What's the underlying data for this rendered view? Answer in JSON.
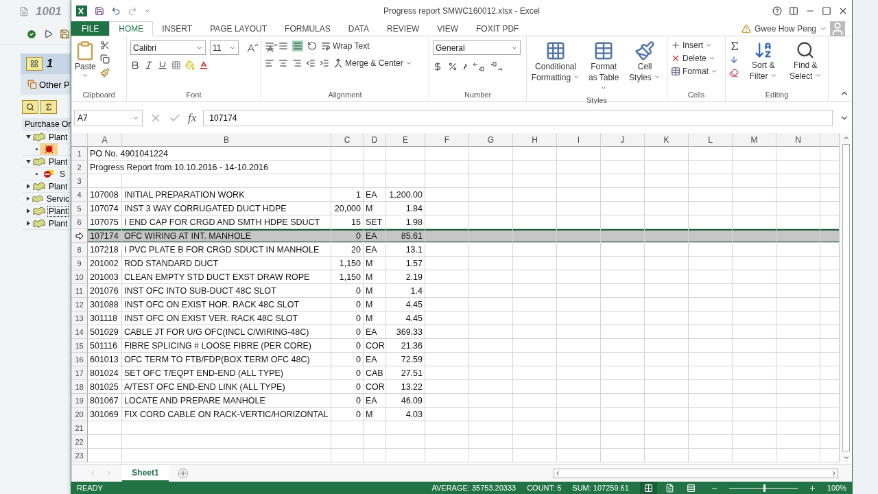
{
  "sap": {
    "title": "1001",
    "app_button": "1",
    "other_button": "Other P",
    "tree_header": "Purchase Or",
    "tree": [
      {
        "label": "Plant",
        "expanded": true,
        "selected": false,
        "children": [
          {
            "kind": "error",
            "selected": true
          }
        ]
      },
      {
        "label": "Plant",
        "expanded": true,
        "selected": false,
        "children": [
          {
            "kind": "stop",
            "label": "S",
            "selected": false
          }
        ]
      },
      {
        "label": "Plant",
        "expanded": false,
        "selected": false
      },
      {
        "label": "Servic",
        "expanded": false,
        "selected": false
      },
      {
        "label": "Plant",
        "expanded": false,
        "selected": true
      },
      {
        "label": "Plant",
        "expanded": false,
        "selected": false
      }
    ]
  },
  "excel": {
    "title": "Progress report SMWC160012.xlsx - Excel",
    "account": "Gwee How Peng",
    "tabs": [
      {
        "label": "FILE",
        "kind": "file",
        "selected": false
      },
      {
        "label": "HOME",
        "kind": "tab",
        "selected": true
      },
      {
        "label": "INSERT",
        "kind": "tab",
        "selected": false
      },
      {
        "label": "PAGE LAYOUT",
        "kind": "tab",
        "selected": false
      },
      {
        "label": "FORMULAS",
        "kind": "tab",
        "selected": false
      },
      {
        "label": "DATA",
        "kind": "tab",
        "selected": false
      },
      {
        "label": "REVIEW",
        "kind": "tab",
        "selected": false
      },
      {
        "label": "VIEW",
        "kind": "tab",
        "selected": false
      },
      {
        "label": "FOXIT PDF",
        "kind": "tab",
        "selected": false
      }
    ],
    "ribbon": {
      "clipboard": {
        "label": "Clipboard",
        "paste": "Paste"
      },
      "font": {
        "label": "Font",
        "name": "Calibri",
        "size": "11"
      },
      "alignment": {
        "label": "Alignment",
        "wrap": "Wrap Text",
        "merge": "Merge & Center"
      },
      "number": {
        "label": "Number",
        "format": "General"
      },
      "styles": {
        "label": "Styles",
        "buttons": [
          "Conditional Formatting",
          "Format as Table",
          "Cell Styles"
        ]
      },
      "cells": {
        "label": "Cells",
        "buttons": [
          "Insert",
          "Delete",
          "Format"
        ]
      },
      "editing": {
        "label": "Editing",
        "buttons": [
          "Sort & Filter",
          "Find & Select"
        ]
      }
    },
    "name_box": "A7",
    "fx": "fx",
    "formula": "107174",
    "columns": [
      "A",
      "B",
      "C",
      "D",
      "E",
      "F",
      "G",
      "H",
      "I",
      "J",
      "K",
      "L",
      "M",
      "N"
    ],
    "rows": [
      {
        "number": "1",
        "selected": false,
        "cells": [
          "PO No. 4901041224"
        ]
      },
      {
        "number": "2",
        "selected": false,
        "cells": [
          "Progress Report from 10.10.2016 - 14-10.2016"
        ]
      },
      {
        "number": "3",
        "selected": false
      },
      {
        "number": "4",
        "selected": false,
        "cells": [
          "107008",
          "INITIAL PREPARATION WORK",
          "1",
          "EA",
          "1,200.00"
        ]
      },
      {
        "number": "5",
        "selected": false,
        "cells": [
          "107074",
          "INST 3 WAY CORRUGATED DUCT HDPE",
          "20,000",
          "M",
          "1.84"
        ]
      },
      {
        "number": "6",
        "selected": false,
        "cells": [
          "107075",
          "I END CAP FOR CRGD AND SMTH HDPE SDUCT",
          "15",
          "SET",
          "1.98"
        ]
      },
      {
        "selected": true,
        "cells": [
          "107174",
          "OFC WIRING AT INT. MANHOLE",
          "0",
          "EA",
          "85.61"
        ]
      },
      {
        "number": "8",
        "selected": false,
        "cells": [
          "107218",
          "I PVC PLATE B FOR CRGD SDUCT IN MANHOLE",
          "20",
          "EA",
          "13.1"
        ]
      },
      {
        "number": "9",
        "selected": false,
        "cells": [
          "201002",
          "ROD STANDARD DUCT",
          "1,150",
          "M",
          "1.57"
        ]
      },
      {
        "number": "10",
        "selected": false,
        "cells": [
          "201003",
          "CLEAN EMPTY STD DUCT EXST DRAW ROPE",
          "1,150",
          "M",
          "2.19"
        ]
      },
      {
        "number": "11",
        "selected": false,
        "cells": [
          "201076",
          "INST OFC INTO SUB-DUCT 48C SLOT",
          "0",
          "M",
          "1.4"
        ]
      },
      {
        "number": "12",
        "selected": false,
        "cells": [
          "301088",
          "INST OFC ON EXIST HOR. RACK 48C SLOT",
          "0",
          "M",
          "4.45"
        ]
      },
      {
        "number": "13",
        "selected": false,
        "cells": [
          "301118",
          "INST OFC ON EXIST VER. RACK 48C SLOT",
          "0",
          "M",
          "4.45"
        ]
      },
      {
        "number": "14",
        "selected": false,
        "cells": [
          "501029",
          "CABLE JT FOR U/G OFC(INCL C/WIRING-48C)",
          "0",
          "EA",
          "369.33"
        ]
      },
      {
        "number": "15",
        "selected": false,
        "cells": [
          "501116",
          "FIBRE SPLICING # LOOSE FIBRE (PER CORE)",
          "0",
          "COR",
          "21.36"
        ]
      },
      {
        "number": "16",
        "selected": false,
        "cells": [
          "601013",
          "OFC TERM TO FTB/FDP(BOX TERM OFC 48C)",
          "0",
          "EA",
          "72.59"
        ]
      },
      {
        "number": "17",
        "selected": false,
        "cells": [
          "801024",
          "SET OFC T/EQPT END-END (ALL TYPE)",
          "0",
          "CAB",
          "27.51"
        ]
      },
      {
        "number": "18",
        "selected": false,
        "cells": [
          "801025",
          "A/TEST OFC END-END LINK (ALL TYPE)",
          "0",
          "COR",
          "13.22"
        ]
      },
      {
        "number": "19",
        "selected": false,
        "cells": [
          "801067",
          "LOCATE AND PREPARE MANHOLE",
          "0",
          "EA",
          "46.09"
        ]
      },
      {
        "number": "20",
        "selected": false,
        "cells": [
          "301069",
          "FIX CORD CABLE ON RACK-VERTIC/HORIZONTAL",
          "0",
          "M",
          "4.03"
        ]
      },
      {
        "number": "21",
        "selected": false
      },
      {
        "number": "22",
        "selected": false
      },
      {
        "number": "23",
        "selected": false
      }
    ],
    "sheet_tabs": [
      {
        "label": "Sheet1",
        "selected": true
      }
    ],
    "status": {
      "mode": "READY",
      "average": "AVERAGE: 35753.20333",
      "count": "COUNT: 5",
      "sum": "SUM: 107259.61",
      "views": [
        {
          "kind": "normal",
          "selected": true
        },
        {
          "kind": "layout",
          "selected": false
        },
        {
          "kind": "break",
          "selected": false
        }
      ],
      "zoom": "100%",
      "level": 0.5
    }
  }
}
